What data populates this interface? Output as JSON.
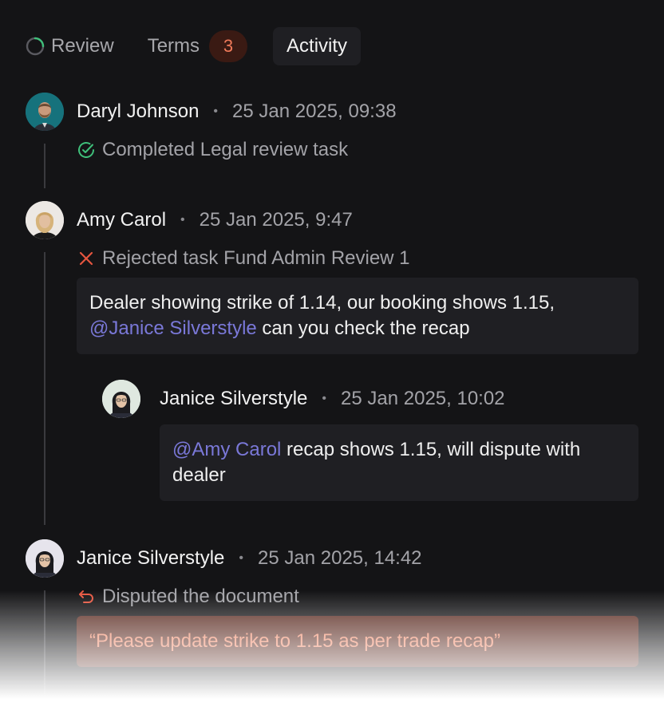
{
  "tabs": {
    "review": {
      "label": "Review",
      "icon": "loading-spinner-icon"
    },
    "terms": {
      "label": "Terms",
      "badge": "3"
    },
    "activity": {
      "label": "Activity"
    }
  },
  "activity": [
    {
      "name": "Daryl Johnson",
      "time": "25 Jan 2025, 09:38",
      "action_icon": "check-circle-icon",
      "action": "Completed Legal review task"
    },
    {
      "name": "Amy Carol",
      "time": "25 Jan 2025, 9:47",
      "action_icon": "close-x-icon",
      "action": "Rejected task Fund Admin Review 1",
      "comment": {
        "text_before": "Dealer showing strike of 1.14, our booking shows 1.15,",
        "mention": "@Janice Silverstyle",
        "text_after": " can you check the recap"
      },
      "reply": {
        "name": "Janice Silverstyle",
        "time": "25 Jan 2025, 10:02",
        "mention": "@Amy Carol",
        "text_after": " recap shows 1.15, will dispute with dealer"
      }
    },
    {
      "name": "Janice Silverstyle",
      "time": "25 Jan 2025, 14:42",
      "action_icon": "undo-arrow-icon",
      "action": "Disputed the document",
      "quote": "“Please update strike to 1.15 as per trade recap”"
    }
  ],
  "colors": {
    "background": "#141416",
    "success": "#3fbf7a",
    "danger": "#e5553f",
    "mention": "#7a78d8",
    "badge_bg": "#3a1a13",
    "badge_text": "#f07a5a"
  }
}
